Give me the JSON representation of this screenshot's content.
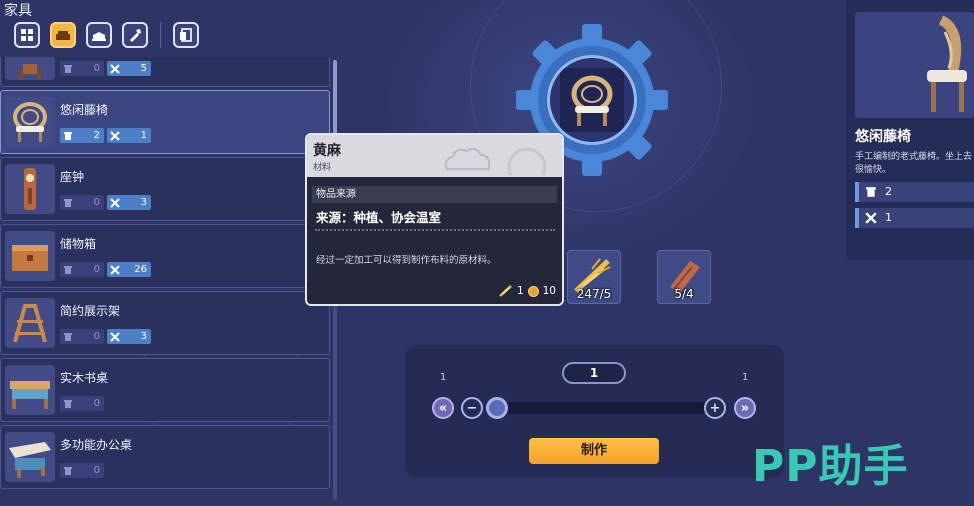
{
  "category_title": "家具",
  "tabs": [
    {
      "name": "all",
      "icon": "grid-icon"
    },
    {
      "name": "furniture",
      "icon": "sofa-icon",
      "active": true
    },
    {
      "name": "decor",
      "icon": "bed-icon"
    },
    {
      "name": "tools",
      "icon": "hammer-icon"
    },
    {
      "name": "blueprints",
      "icon": "blueprint-icon"
    }
  ],
  "list": [
    {
      "name": "",
      "owned": "0",
      "craftable": "5"
    },
    {
      "name": "悠闲藤椅",
      "owned": "2",
      "craftable": "1",
      "selected": true
    },
    {
      "name": "座钟",
      "owned": "0",
      "craftable": "3"
    },
    {
      "name": "储物箱",
      "owned": "0",
      "craftable": "26"
    },
    {
      "name": "简约展示架",
      "owned": "0",
      "craftable": "3"
    },
    {
      "name": "实木书桌",
      "owned": "0",
      "craftable": ""
    },
    {
      "name": "多功能办公桌",
      "owned": "0",
      "craftable": ""
    }
  ],
  "tooltip": {
    "title": "黄麻",
    "subtitle": "材料",
    "source_header": "物品来源",
    "source": "来源：种植、协会温室",
    "description": "经过一定加工可以得到制作布料的原材料。",
    "rarity": "1",
    "price": "10"
  },
  "materials": [
    {
      "name": "jute",
      "count": "247/5"
    },
    {
      "name": "wood",
      "count": "5/4"
    }
  ],
  "craft": {
    "quantity": "1",
    "min": "1",
    "max": "1",
    "make_label": "制作"
  },
  "detail": {
    "name": "悠闲藤椅",
    "description": "手工编制的老式藤椅。坐上去很愉快。",
    "owned": "2",
    "craftable": "1"
  },
  "watermark": "PP助手"
}
